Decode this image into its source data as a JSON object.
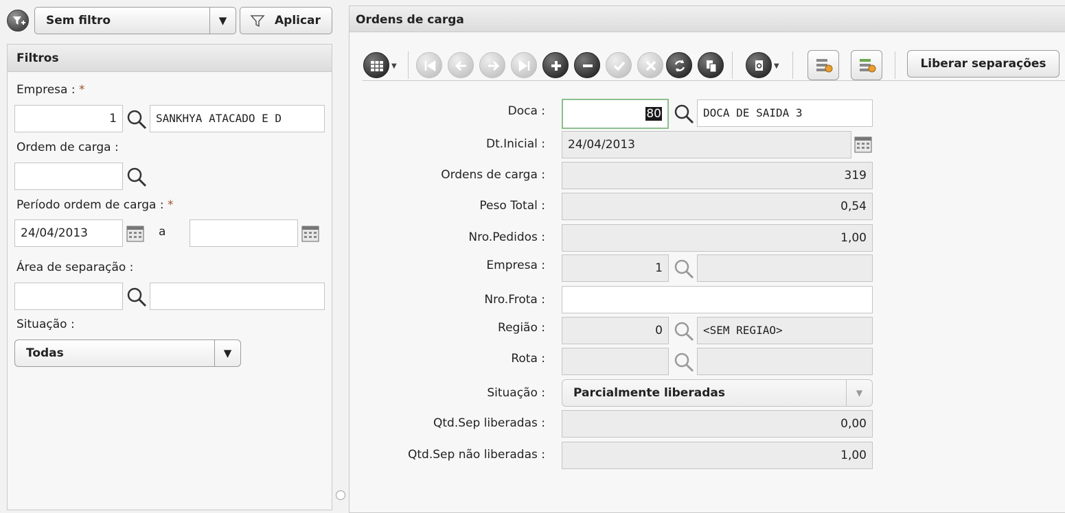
{
  "filter_bar": {
    "selected": "Sem filtro",
    "apply_label": "Aplicar"
  },
  "filters": {
    "title": "Filtros",
    "empresa_label": "Empresa :",
    "empresa_code": "1",
    "empresa_name": "SANKHYA ATACADO E D",
    "ordem_label": "Ordem de carga :",
    "ordem_value": "",
    "periodo_label": "Período ordem de carga :",
    "periodo_from": "24/04/2013",
    "periodo_sep": "a",
    "periodo_to": "",
    "area_label": "Área de separação :",
    "area_code": "",
    "area_name": "",
    "situacao_label": "Situação :",
    "situacao_value": "Todas",
    "required_mark": "*"
  },
  "main": {
    "title": "Ordens de carga",
    "liberar_label": "Liberar separações",
    "toolbar_icons": [
      "grid-menu-icon",
      "first-record-icon",
      "prev-record-icon",
      "next-record-icon",
      "last-record-icon",
      "add-icon",
      "remove-icon",
      "confirm-icon",
      "cancel-icon",
      "refresh-icon",
      "copy-icon",
      "attachment-menu-icon",
      "config-icon",
      "config-alt-icon"
    ],
    "form": {
      "doca_label": "Doca :",
      "doca_code": "80",
      "doca_name": "DOCA DE SAIDA 3",
      "dtinicial_label": "Dt.Inicial :",
      "dtinicial_value": "24/04/2013",
      "ordens_label": "Ordens de carga :",
      "ordens_value": "319",
      "peso_label": "Peso Total :",
      "peso_value": "0,54",
      "pedidos_label": "Nro.Pedidos :",
      "pedidos_value": "1,00",
      "empresa_label": "Empresa :",
      "empresa_code": "1",
      "empresa_name": "",
      "frota_label": "Nro.Frota :",
      "frota_value": "",
      "regiao_label": "Região :",
      "regiao_code": "0",
      "regiao_name": "<SEM REGIAO>",
      "rota_label": "Rota :",
      "rota_code": "",
      "rota_name": "",
      "situacao_label": "Situação :",
      "situacao_value": "Parcialmente liberadas",
      "qtdlib_label": "Qtd.Sep liberadas :",
      "qtdlib_value": "0,00",
      "qtdnlib_label": "Qtd.Sep não liberadas :",
      "qtdnlib_value": "1,00"
    }
  },
  "colors": {
    "focus_border": "#8cbf8c",
    "required": "#a0522d"
  }
}
